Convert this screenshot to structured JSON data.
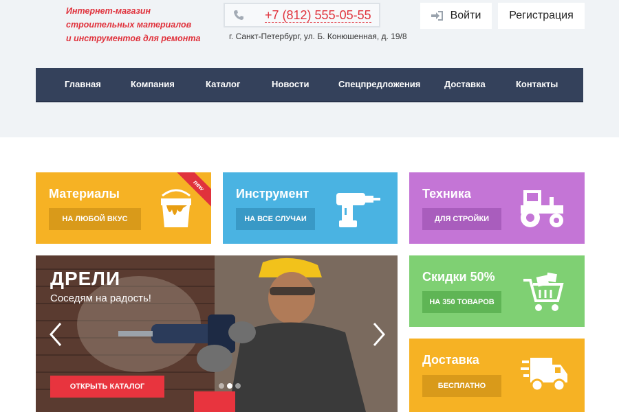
{
  "header": {
    "tagline_lines": [
      "Интернет-магазин",
      "строительных материалов",
      "и инструментов для ремонта"
    ],
    "phone": "+7 (812) 555-05-55",
    "address": "г. Санкт-Петербург, ул. Б. Конюшенная, д. 19/8",
    "login_label": "Войти",
    "register_label": "Регистрация"
  },
  "nav": {
    "items": [
      "Главная",
      "Компания",
      "Каталог",
      "Новости",
      "Спецпредложения",
      "Доставка",
      "Контакты"
    ]
  },
  "tiles": {
    "materials": {
      "title": "Материалы",
      "button": "НА ЛЮБОЙ ВКУС",
      "badge": "new",
      "color": "#f6b224",
      "btn_color": "#d99a1a",
      "icon": "paint-bucket-icon"
    },
    "tools": {
      "title": "Инструмент",
      "button": "НА ВСЕ СЛУЧАИ",
      "color": "#4ab3e2",
      "btn_color": "#3999c6",
      "icon": "drill-icon"
    },
    "machinery": {
      "title": "Техника",
      "button": "ДЛЯ СТРОЙКИ",
      "color": "#c475d6",
      "btn_color": "#a95dbd",
      "icon": "tractor-icon"
    },
    "discount": {
      "title": "Скидки 50%",
      "button": "НА 350 ТОВАРОВ",
      "color": "#7fd073",
      "btn_color": "#5fb555",
      "icon": "cart-icon"
    },
    "delivery": {
      "title": "Доставка",
      "button": "БЕСПЛАТНО",
      "color": "#f6b224",
      "btn_color": "#d99a1a",
      "icon": "truck-icon"
    }
  },
  "slider": {
    "title": "ДРЕЛИ",
    "subtitle": "Соседям на радость!",
    "cta": "ОТКРЫТЬ КАТАЛОГ",
    "dots": 3,
    "active_dot": 1
  }
}
